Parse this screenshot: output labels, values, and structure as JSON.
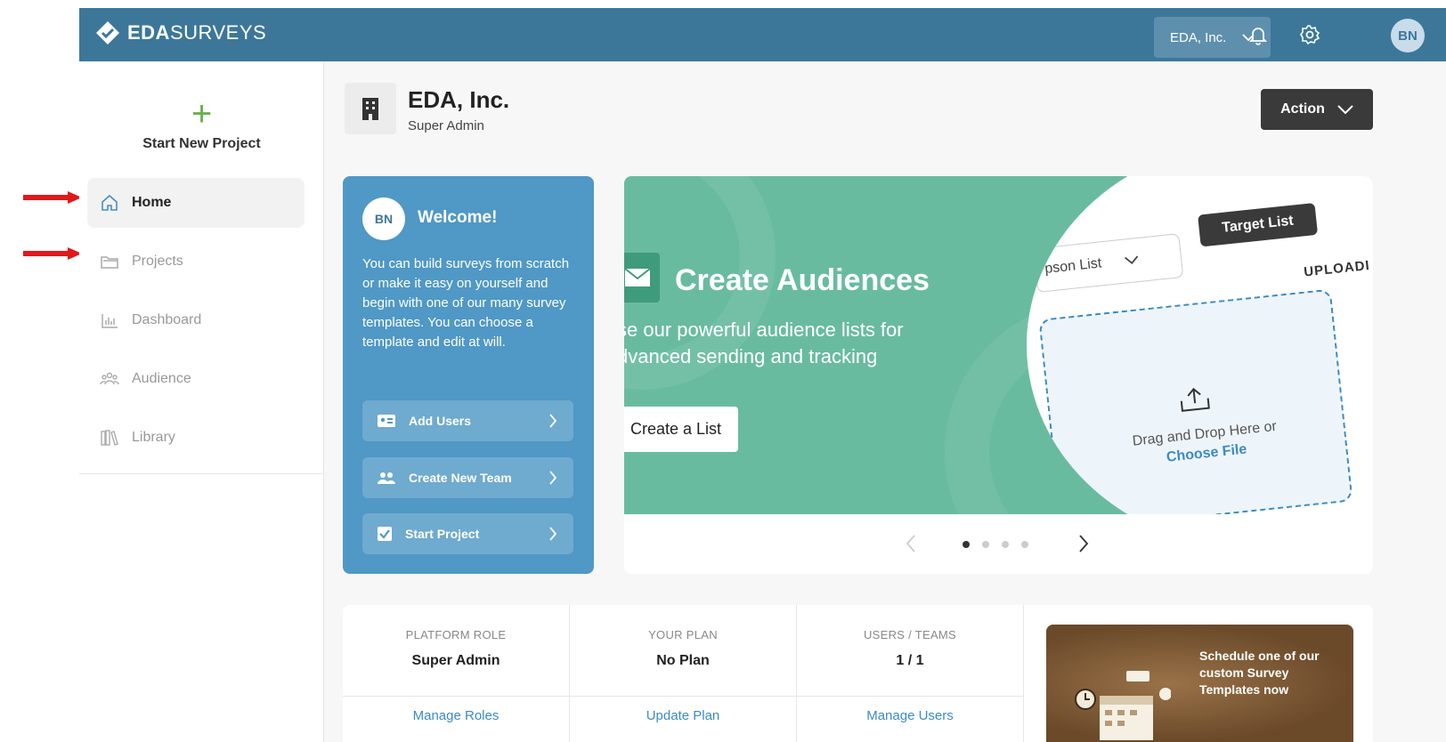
{
  "brand": {
    "bold": "EDA",
    "rest": "SURVEYS"
  },
  "topbar": {
    "org_select": "EDA, Inc.",
    "avatar": "BN"
  },
  "sidebar": {
    "new_project_label": "Start New Project",
    "items": [
      {
        "label": "Home",
        "icon": "home-icon",
        "active": true
      },
      {
        "label": "Projects",
        "icon": "folder-icon"
      },
      {
        "label": "Dashboard",
        "icon": "bar-chart-icon"
      },
      {
        "label": "Audience",
        "icon": "people-icon"
      },
      {
        "label": "Library",
        "icon": "books-icon"
      }
    ]
  },
  "org": {
    "name": "EDA, Inc.",
    "role": "Super Admin"
  },
  "action_label": "Action",
  "welcome": {
    "avatar": "BN",
    "title": "Welcome!",
    "text": "You can build surveys from scratch or make it easy on yourself and begin with one of our many survey templates. You can choose a template and edit at will.",
    "buttons": [
      {
        "label": "Add Users",
        "icon": "id-card-icon"
      },
      {
        "label": "Create New Team",
        "icon": "team-icon"
      },
      {
        "label": "Start Project",
        "icon": "checkbox-icon"
      }
    ]
  },
  "carousel": {
    "title": "Create Audiences",
    "subtitle": "se our powerful audience lists for dvanced sending and tracking",
    "button": "Create a List",
    "select_text": "pson List",
    "target_tag": "Target List",
    "upload_head": "UPLOADI",
    "drop_text": "Drag and Drop Here or",
    "drop_link": "Choose File",
    "slide_count": 4,
    "active_slide": 1
  },
  "stats": [
    {
      "label": "PLATFORM ROLE",
      "value": "Super Admin",
      "link": "Manage Roles"
    },
    {
      "label": "YOUR PLAN",
      "value": "No Plan",
      "link": "Update Plan"
    },
    {
      "label": "USERS / TEAMS",
      "value": "1 / 1",
      "link": "Manage Users"
    }
  ],
  "promo": {
    "text": "Schedule one of our custom Survey Templates now"
  },
  "colors": {
    "header": "#3c779a",
    "accent": "#5098c5",
    "plus": "#6ab04c",
    "slide": "#69bba0",
    "annotation_arrow": "#e0191b"
  }
}
